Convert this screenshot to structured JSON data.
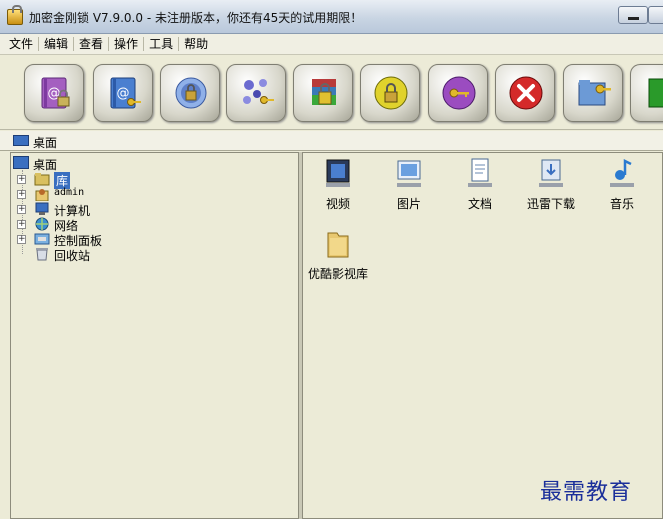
{
  "window": {
    "title": "加密金刚锁 V7.9.0.0 - 未注册版本，你还有45天的试用期限！"
  },
  "menu": [
    "文件",
    "编辑",
    "查看",
    "操作",
    "工具",
    "帮助"
  ],
  "toolbar": {
    "buttons": [
      {
        "icon": "encrypt-book-icon",
        "color": "#a45fc0"
      },
      {
        "icon": "decrypt-book-icon",
        "color": "#4a7fd0"
      },
      {
        "icon": "network-lock-icon",
        "color": "#5d7fc8"
      },
      {
        "icon": "key-molecule-icon",
        "color": "#6b6bd0"
      },
      {
        "icon": "archive-lock-icon",
        "color": "#b83a3a"
      },
      {
        "icon": "padlock-icon",
        "color": "#e0d22c"
      },
      {
        "icon": "key-circle-icon",
        "color": "#9b4cc0"
      },
      {
        "icon": "close-icon",
        "color": "#d42a2a"
      },
      {
        "icon": "folder-key-icon",
        "color": "#6c9ad6"
      },
      {
        "icon": "exit-icon",
        "color": "#2a9a2a"
      }
    ]
  },
  "address": {
    "text": "桌面"
  },
  "tree": {
    "root": "桌面",
    "items": [
      "库",
      "admin",
      "计算机",
      "网络",
      "控制面板",
      "回收站"
    ]
  },
  "files": [
    {
      "label": "视频",
      "icon": "video-library-icon"
    },
    {
      "label": "图片",
      "icon": "picture-library-icon"
    },
    {
      "label": "文档",
      "icon": "document-library-icon"
    },
    {
      "label": "迅雷下载",
      "icon": "download-library-icon"
    },
    {
      "label": "音乐",
      "icon": "music-library-icon"
    },
    {
      "label": "优酷影视库",
      "icon": "folder-icon"
    }
  ],
  "watermark": "最需教育"
}
